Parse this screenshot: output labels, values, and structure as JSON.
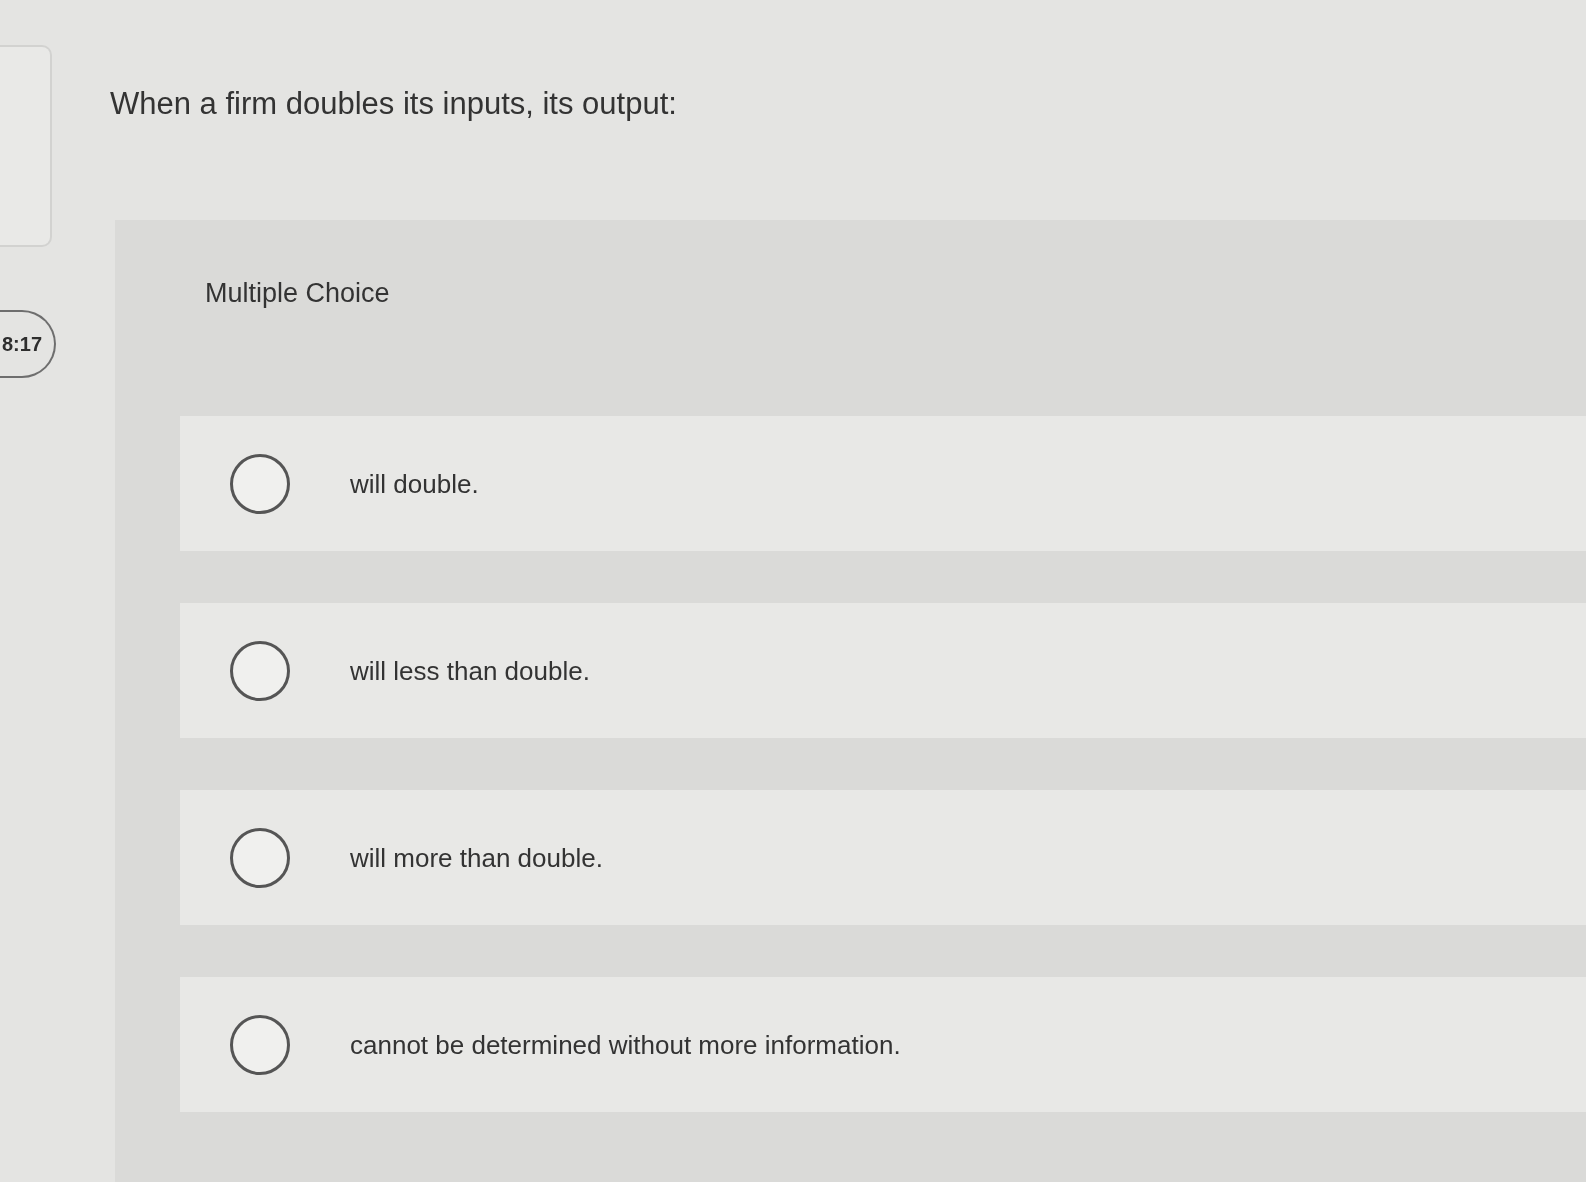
{
  "timer": "8:17",
  "question": "When a firm doubles its inputs, its output:",
  "answer_panel": {
    "type_label": "Multiple Choice",
    "options": [
      {
        "text": "will double.",
        "selected": false
      },
      {
        "text": "will less than double.",
        "selected": false
      },
      {
        "text": "will more than double.",
        "selected": false
      },
      {
        "text": "cannot be determined without more information.",
        "selected": false
      }
    ]
  }
}
